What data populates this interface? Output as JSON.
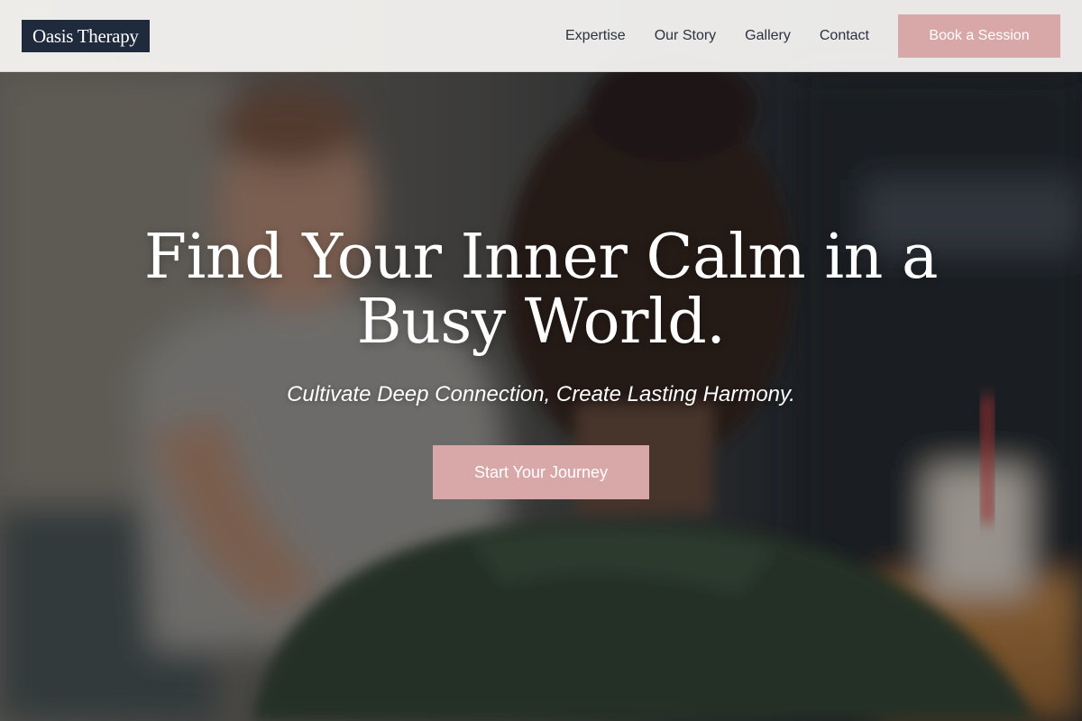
{
  "brand": {
    "logo_text": "Oasis Therapy",
    "accent_color": "#d8a7a8",
    "logo_bg_color": "#1f2a3d"
  },
  "nav": {
    "items": [
      {
        "label": "Expertise"
      },
      {
        "label": "Our Story"
      },
      {
        "label": "Gallery"
      },
      {
        "label": "Contact"
      }
    ],
    "book_label": "Book a Session"
  },
  "hero": {
    "title": "Find Your Inner Calm in a Busy World.",
    "subtitle": "Cultivate Deep Connection, Create Lasting Harmony.",
    "cta_label": "Start Your Journey",
    "background_image": "blurred-photo-couple-in-cafe"
  }
}
